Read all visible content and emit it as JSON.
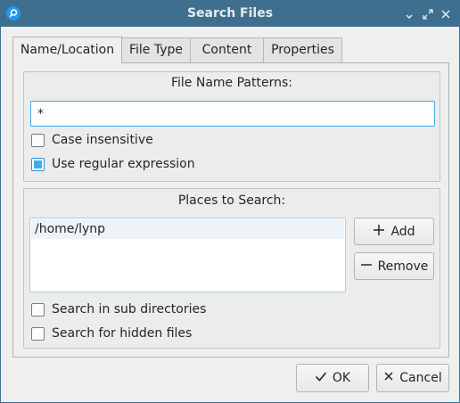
{
  "window": {
    "title": "Search Files",
    "icons": {
      "app": "search-app-icon",
      "minimize": "minimize-icon",
      "maximize": "maximize-icon",
      "close": "close-icon"
    }
  },
  "tabs": [
    {
      "label": "Name/Location",
      "active": true
    },
    {
      "label": "File Type",
      "active": false
    },
    {
      "label": "Content",
      "active": false
    },
    {
      "label": "Properties",
      "active": false
    }
  ],
  "patterns": {
    "title": "File Name Patterns:",
    "value": "*",
    "case_insensitive": {
      "label": "Case insensitive",
      "checked": false
    },
    "regex": {
      "label": "Use regular expression",
      "checked": true
    }
  },
  "places": {
    "title": "Places to Search:",
    "items": [
      "/home/lynp"
    ],
    "add_label": "Add",
    "remove_label": "Remove",
    "sub_dirs": {
      "label": "Search in sub directories",
      "checked": false
    },
    "hidden": {
      "label": "Search for hidden files",
      "checked": false
    }
  },
  "footer": {
    "ok_label": "OK",
    "cancel_label": "Cancel"
  },
  "colors": {
    "titlebar": "#3f6f8f",
    "accent": "#3daee9",
    "window_bg": "#efefef"
  }
}
